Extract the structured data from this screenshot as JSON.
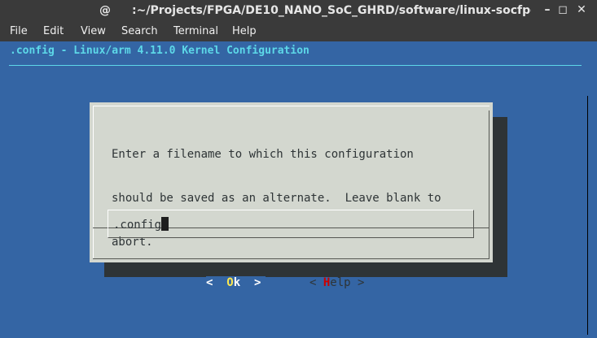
{
  "window": {
    "icon": "@",
    "title": ":~/Projects/FPGA/DE10_NANO_SoC_GHRD/software/linux-socfpga",
    "controls": [
      "–",
      "◻",
      "✕"
    ]
  },
  "menu": {
    "items": [
      "File",
      "Edit",
      "View",
      "Search",
      "Terminal",
      "Help"
    ]
  },
  "kconfig": {
    "header": ".config - Linux/arm 4.11.0 Kernel Configuration"
  },
  "dialog": {
    "prompt_lines": [
      "Enter a filename to which this configuration",
      "should be saved as an alternate.  Leave blank to",
      "abort."
    ],
    "input_value": ".config",
    "ok": {
      "left": "<  ",
      "hot": "O",
      "rest": "k",
      "right": "  >"
    },
    "help": {
      "left": "< ",
      "hot": "H",
      "rest": "elp",
      "right": " >"
    }
  },
  "colors": {
    "terminal_bg": "#3465a4",
    "header_text": "#5dd8e8",
    "dialog_bg": "#d3d7cf",
    "shadow": "#2e3436",
    "hotkey_ok": "#fce94f",
    "hotkey_help": "#cc0000"
  }
}
